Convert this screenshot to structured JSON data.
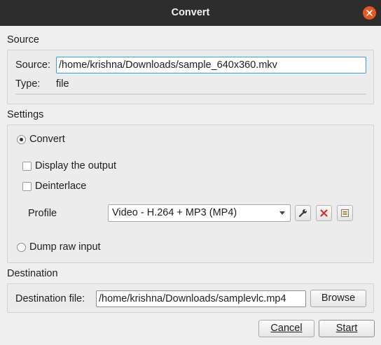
{
  "window": {
    "title": "Convert"
  },
  "source": {
    "section_label": "Source",
    "source_label": "Source:",
    "source_value": "/home/krishna/Downloads/sample_640x360.mkv",
    "type_label": "Type:",
    "type_value": "file"
  },
  "settings": {
    "section_label": "Settings",
    "convert_label": "Convert",
    "convert_selected": true,
    "display_output_label": "Display the output",
    "display_output_checked": false,
    "deinterlace_label": "Deinterlace",
    "deinterlace_checked": false,
    "profile_label": "Profile",
    "profile_value": "Video - H.264 + MP3 (MP4)",
    "profile_tools": [
      "wrench-icon",
      "delete-icon",
      "new-profile-icon"
    ],
    "dump_raw_label": "Dump raw input",
    "dump_raw_selected": false
  },
  "destination": {
    "section_label": "Destination",
    "file_label": "Destination file:",
    "file_value": "/home/krishna/Downloads/samplevlc.mp4",
    "browse_label": "Browse"
  },
  "footer": {
    "cancel_label": "Cancel",
    "start_label": "Start"
  },
  "colors": {
    "titlebar": "#2d2d2d",
    "close": "#e95420",
    "focus": "#3aa0e0",
    "delete": "#d0302a"
  }
}
